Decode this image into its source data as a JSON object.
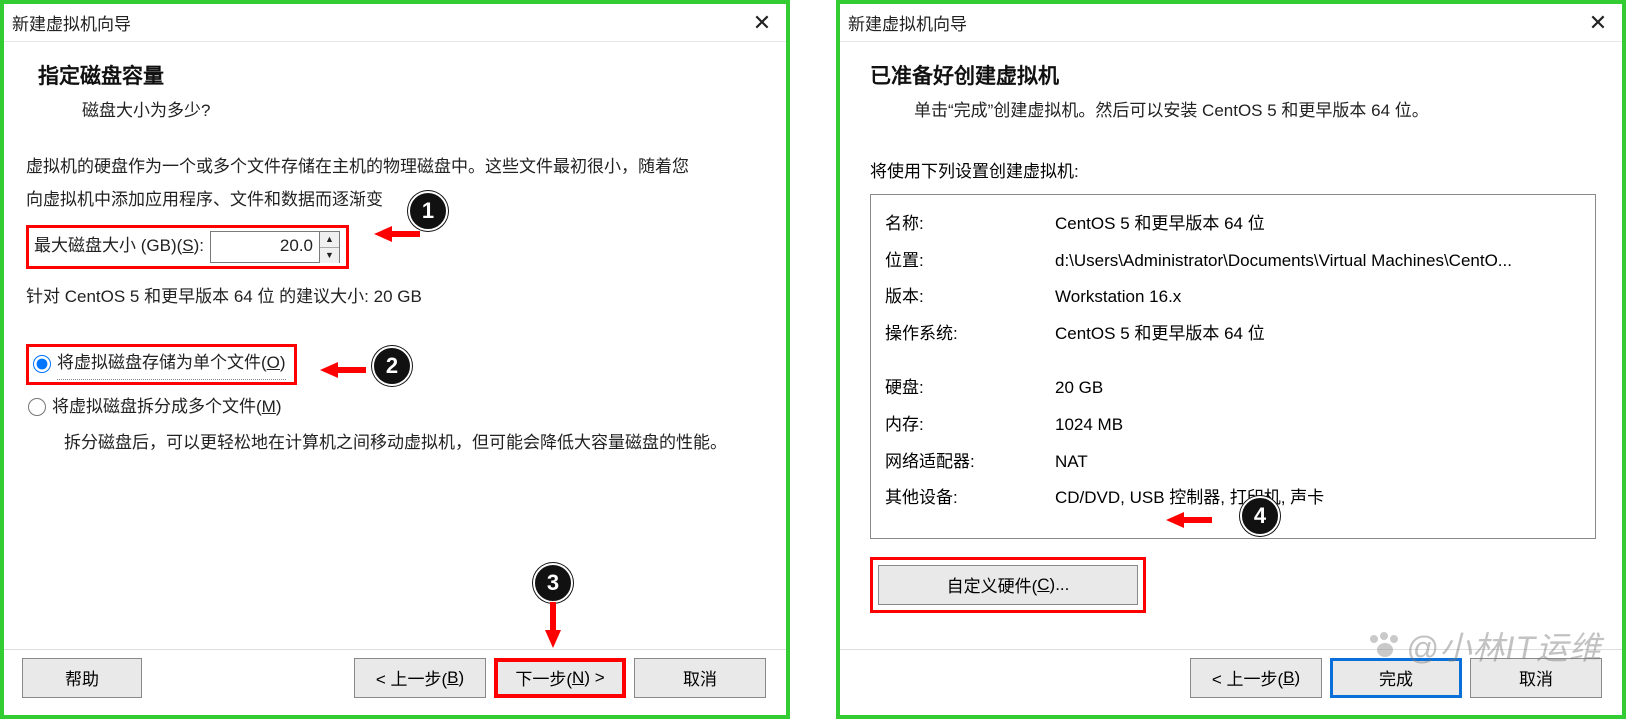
{
  "left": {
    "window_title": "新建虚拟机向导",
    "heading": "指定磁盘容量",
    "subheading": "磁盘大小为多少?",
    "para_line1": "虚拟机的硬盘作为一个或多个文件存储在主机的物理磁盘中。这些文件最初很小，随着您",
    "para_line2": "向虚拟机中添加应用程序、文件和数据而逐渐变",
    "disk_label_pre": "最大磁盘大小 (GB)(",
    "disk_label_key": "S",
    "disk_label_post": "):",
    "disk_value": "20.0",
    "recommend": "针对 CentOS 5 和更早版本 64 位 的建议大小: 20 GB",
    "radio_single_pre": "将虚拟磁盘存储为单个文件(",
    "radio_single_key": "O",
    "radio_single_post": ")",
    "radio_split_pre": "将虚拟磁盘拆分成多个文件(",
    "radio_split_key": "M",
    "radio_split_post": ")",
    "split_desc": "拆分磁盘后，可以更轻松地在计算机之间移动虚拟机，但可能会降低大容量磁盘的性能。",
    "btn_help": "帮助",
    "btn_back_pre": "< 上一步(",
    "btn_back_key": "B",
    "btn_back_post": ")",
    "btn_next_pre": "下一步(",
    "btn_next_key": "N",
    "btn_next_post": ") >",
    "btn_cancel": "取消",
    "badge1": "1",
    "badge2": "2",
    "badge3": "3"
  },
  "right": {
    "window_title": "新建虚拟机向导",
    "heading": "已准备好创建虚拟机",
    "subheading": "单击“完成”创建虚拟机。然后可以安装 CentOS 5 和更早版本 64 位。",
    "intro": "将使用下列设置创建虚拟机:",
    "kv": {
      "name_k": "名称:",
      "name_v": "CentOS 5 和更早版本 64 位",
      "loc_k": "位置:",
      "loc_v": "d:\\Users\\Administrator\\Documents\\Virtual Machines\\CentO...",
      "ver_k": "版本:",
      "ver_v": "Workstation 16.x",
      "os_k": "操作系统:",
      "os_v": "CentOS 5 和更早版本 64 位",
      "disk_k": "硬盘:",
      "disk_v": "20 GB",
      "mem_k": "内存:",
      "mem_v": "1024 MB",
      "net_k": "网络适配器:",
      "net_v": "NAT",
      "other_k": "其他设备:",
      "other_v": "CD/DVD, USB 控制器, 打印机, 声卡"
    },
    "btn_customize_pre": "自定义硬件(",
    "btn_customize_key": "C",
    "btn_customize_post": ")...",
    "btn_back_pre": "< 上一步(",
    "btn_back_key": "B",
    "btn_back_post": ")",
    "btn_finish": "完成",
    "btn_cancel": "取消",
    "badge4": "4",
    "watermark": "@小林IT运维"
  }
}
